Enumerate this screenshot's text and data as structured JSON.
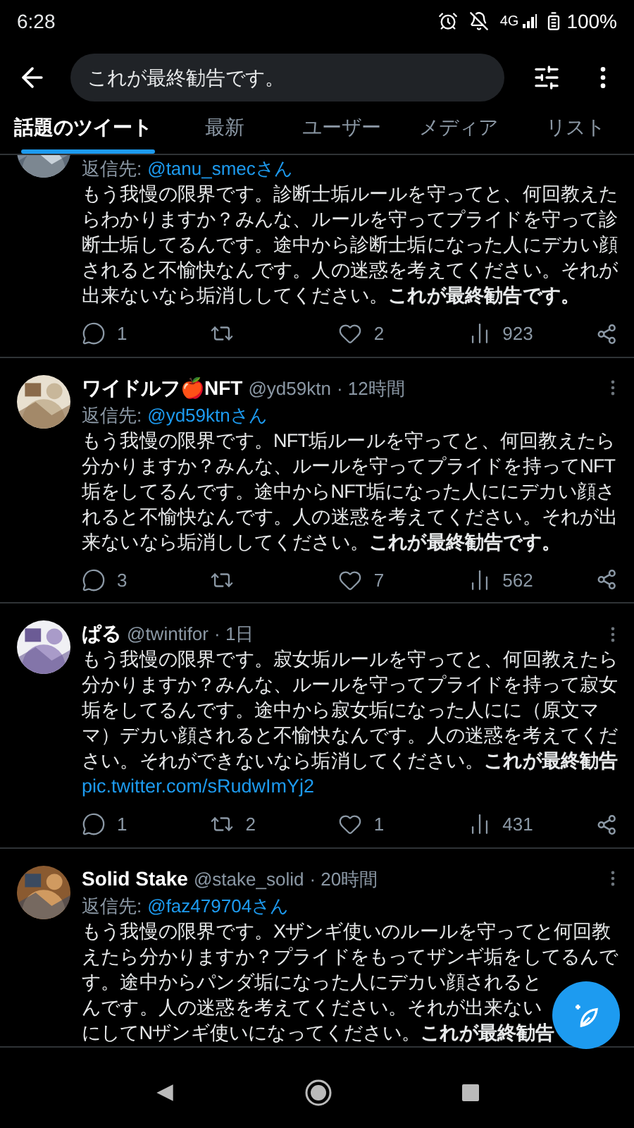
{
  "status_bar": {
    "time": "6:28",
    "network": "4G",
    "battery": "100%"
  },
  "search": {
    "value": "これが最終勧告です。"
  },
  "tabs": [
    {
      "label": "話題のツイート",
      "selected": true
    },
    {
      "label": "最新",
      "selected": false
    },
    {
      "label": "ユーザー",
      "selected": false
    },
    {
      "label": "メディア",
      "selected": false
    },
    {
      "label": "リスト",
      "selected": false
    }
  ],
  "tweets": [
    {
      "reply_label": "返信先:",
      "reply_to": "@tanu_smecさん",
      "lines": [
        "もう我慢の限界です。診断士垢ルールを守ってと、何回教えた",
        "らわかりますか？みんな、ルールを守ってプライドを守って診",
        "断士垢してるんです。途中から診断士垢になった人にデカい顔",
        "されると不愉快なんです。人の迷惑を考えてください。それが",
        "出来ないなら垢消ししてください。**これが最終勧告です。**"
      ],
      "replies": "1",
      "likes": "2",
      "views": "923"
    },
    {
      "name": "ワイドルフ🍎NFT",
      "handle": "@yd59ktn",
      "time": "· 12時間",
      "reply_label": "返信先:",
      "reply_to": "@yd59ktnさん",
      "lines": [
        "もう我慢の限界です。NFT垢ルールを守ってと、何回教えたら",
        "分かりますか？みんな、ルールを守ってプライドを持ってNFT",
        "垢をしてるんです。途中からNFT垢になった人ににデカい顔さ",
        "れると不愉快なんです。人の迷惑を考えてください。それが出",
        "来ないなら垢消ししてください。**これが最終勧告です。**"
      ],
      "replies": "3",
      "likes": "7",
      "views": "562"
    },
    {
      "name": "ぱる",
      "handle": "@twintifor",
      "time": "· 1日",
      "lines": [
        "もう我慢の限界です。寂女垢ルールを守ってと、何回教えたら",
        "分かりますか？みんな、ルールを守ってプライドを持って寂女",
        "垢をしてるんです。途中から寂女垢になった人にに（原文マ",
        "マ）デカい顔されると不愉快なんです。人の迷惑を考えてくだ",
        "さい。それができないなら垢消してください。**これが最終勧告**"
      ],
      "link": "pic.twitter.com/sRudwImYj2",
      "replies": "1",
      "retweets": "2",
      "likes": "1",
      "views": "431"
    },
    {
      "name": "Solid Stake",
      "handle": "@stake_solid",
      "time": "· 20時間",
      "reply_label": "返信先:",
      "reply_to": "@faz479704さん",
      "lines": [
        "もう我慢の限界です。Xザンギ使いのルールを守ってと何回教",
        "えたら分かりますか？プライドをもってザンギ垢をしてるんで",
        "す。途中からパンダ垢になった人にデカい顔されると",
        "んです。人の迷惑を考えてください。それが出来ない",
        "にしてNザンギ使いになってください。**これが最終勧告**"
      ]
    }
  ]
}
